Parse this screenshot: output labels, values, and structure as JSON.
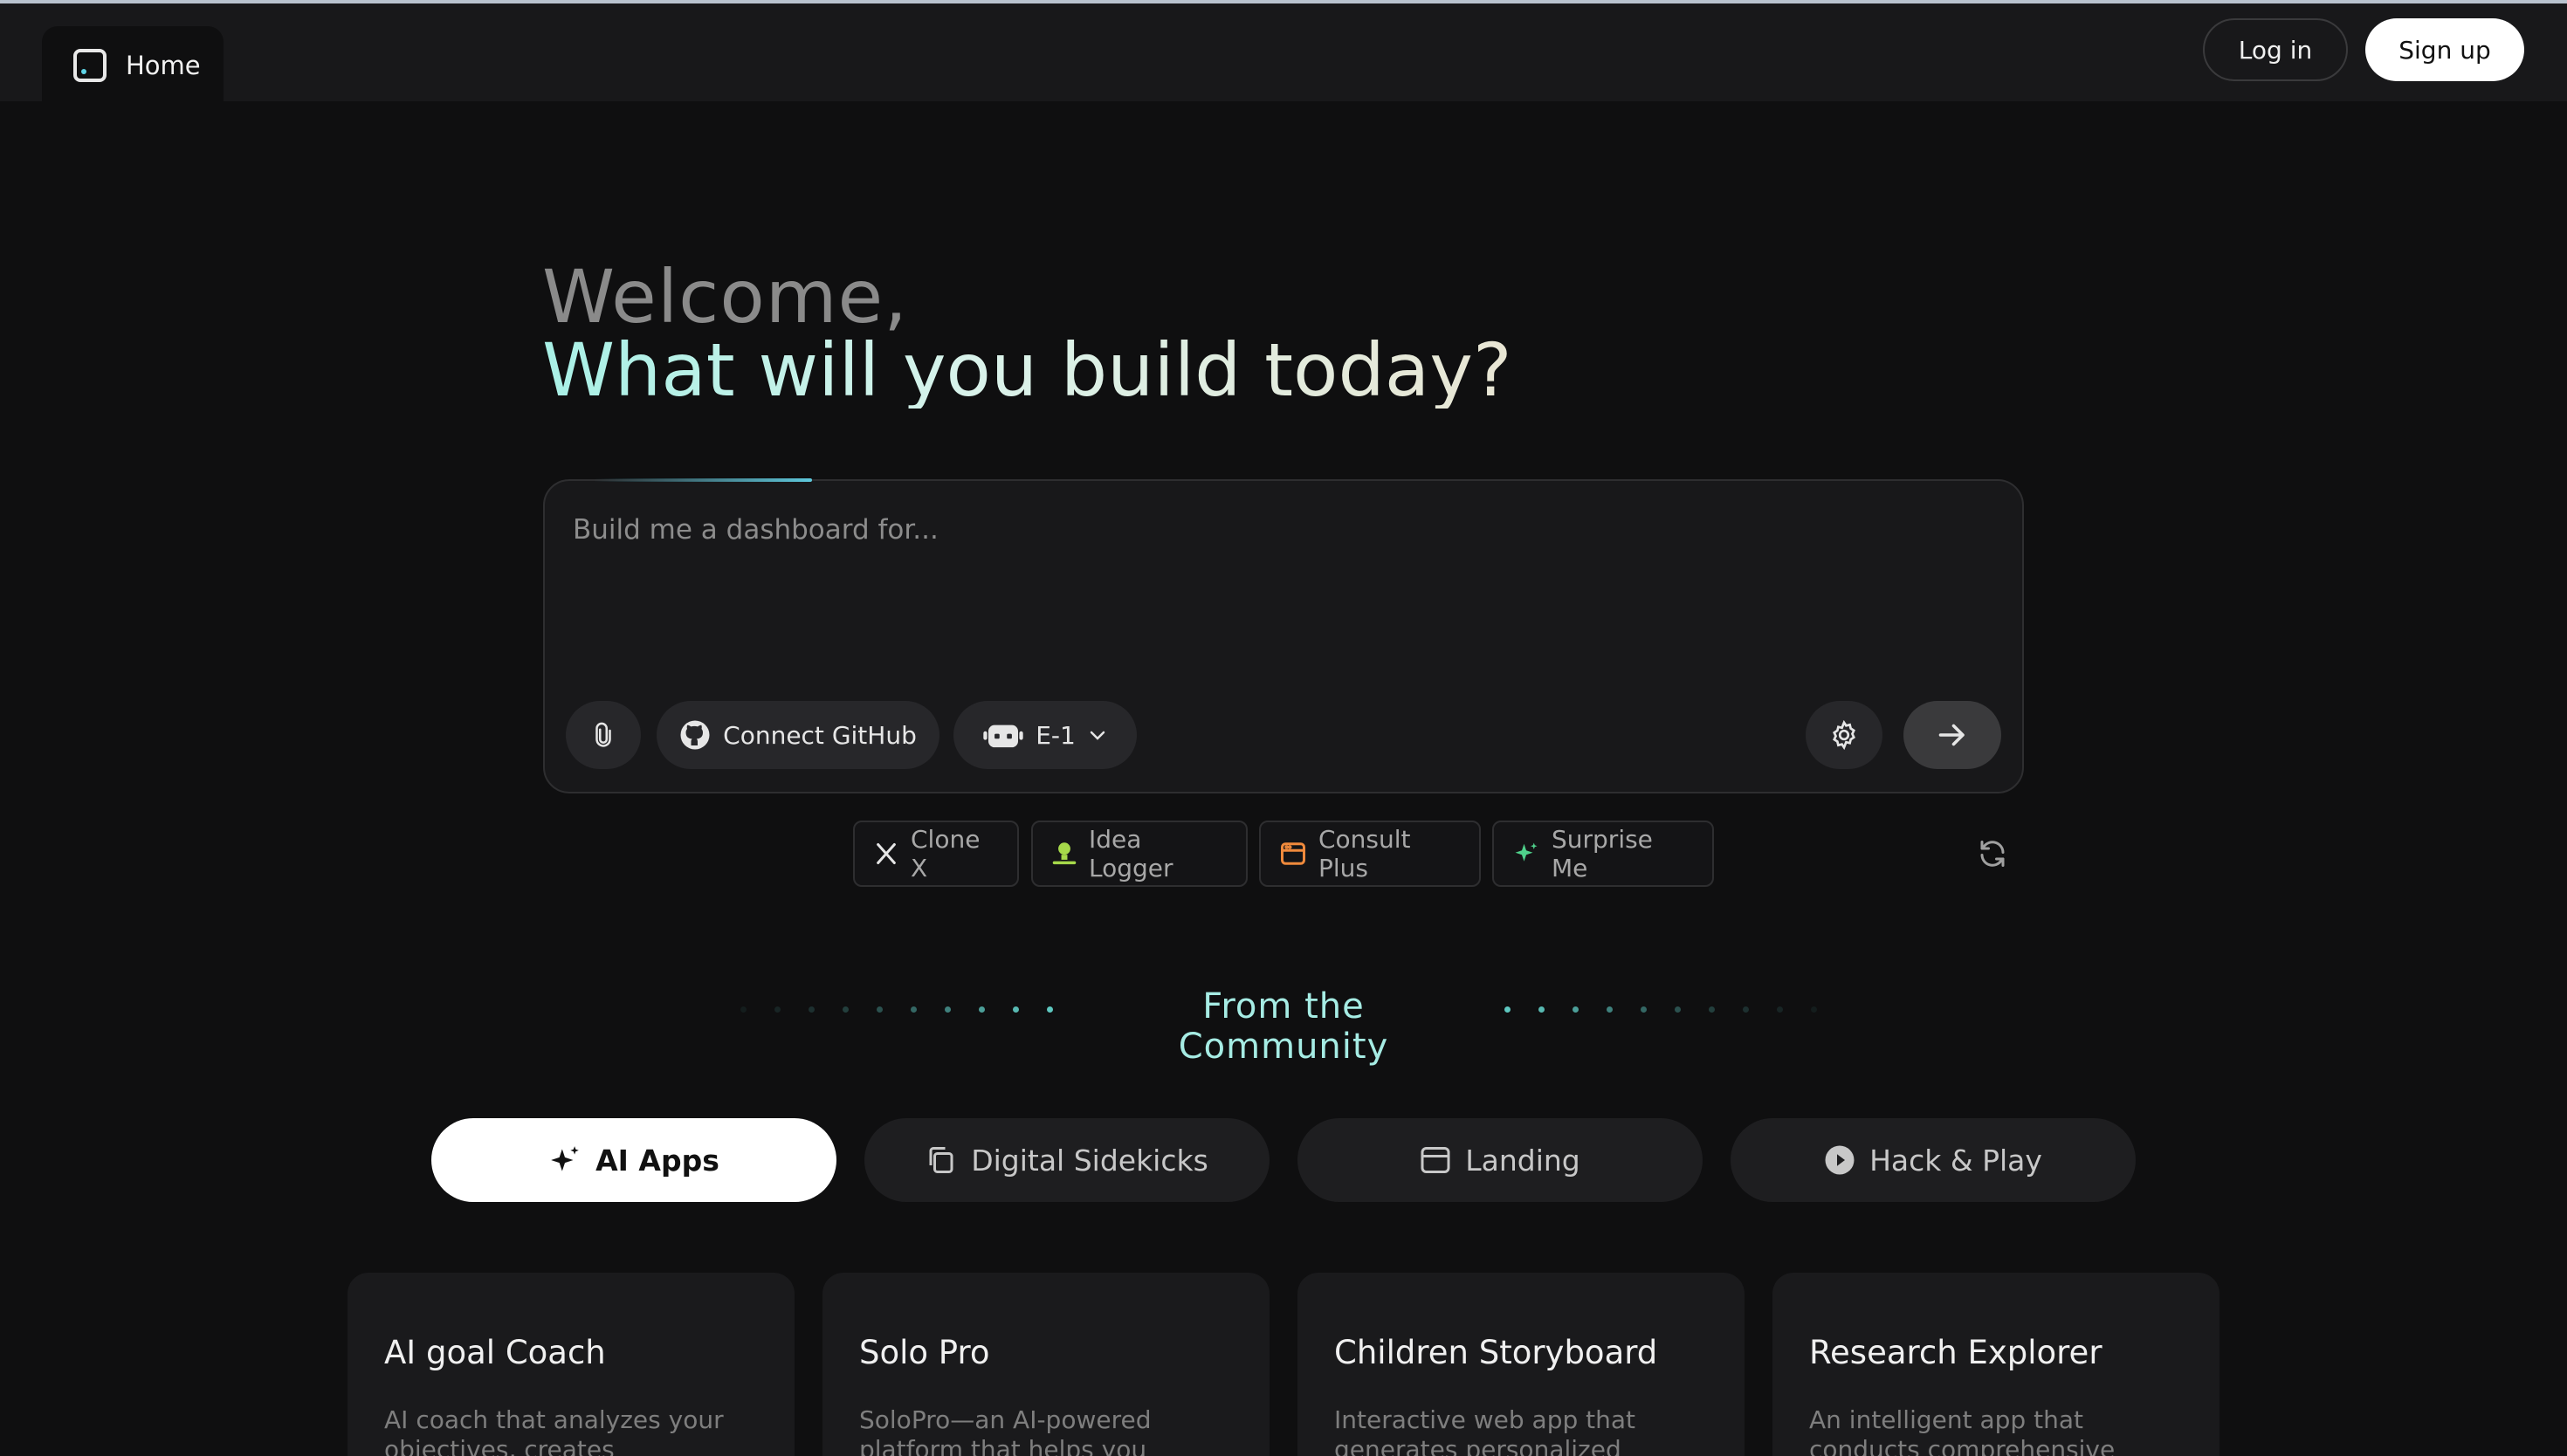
{
  "topbar": {
    "home_label": "Home",
    "login_label": "Log in",
    "signup_label": "Sign up"
  },
  "hero": {
    "welcome": "Welcome,",
    "headline": "What will you build today?"
  },
  "prompt": {
    "placeholder": "Build me a dashboard for...",
    "github_label": "Connect GitHub",
    "model_label": "E-1"
  },
  "suggestions": [
    {
      "label": "Clone X",
      "icon": "x-logo-icon"
    },
    {
      "label": "Idea Logger",
      "icon": "lightbulb-icon"
    },
    {
      "label": "Consult Plus",
      "icon": "window-icon"
    },
    {
      "label": "Surprise Me",
      "icon": "sparkle-icon"
    }
  ],
  "community": {
    "title": "From the Community"
  },
  "tabs": [
    {
      "label": "AI Apps",
      "icon": "sparkle-icon",
      "active": true
    },
    {
      "label": "Digital Sidekicks",
      "icon": "copy-icon",
      "active": false
    },
    {
      "label": "Landing",
      "icon": "browser-icon",
      "active": false
    },
    {
      "label": "Hack & Play",
      "icon": "play-icon",
      "active": false
    }
  ],
  "cards": [
    {
      "title": "AI goal Coach",
      "desc": "AI coach that analyzes your objectives, creates"
    },
    {
      "title": "Solo Pro",
      "desc": "SoloPro—an AI-powered platform that helps you"
    },
    {
      "title": "Children Storyboard",
      "desc": "Interactive web app that generates personalized"
    },
    {
      "title": "Research Explorer",
      "desc": "An intelligent app that conducts comprehensive research on"
    }
  ],
  "colors": {
    "accent": "#5ec8dc",
    "headline_start": "#a8f0e6",
    "background": "#0f0f10"
  }
}
